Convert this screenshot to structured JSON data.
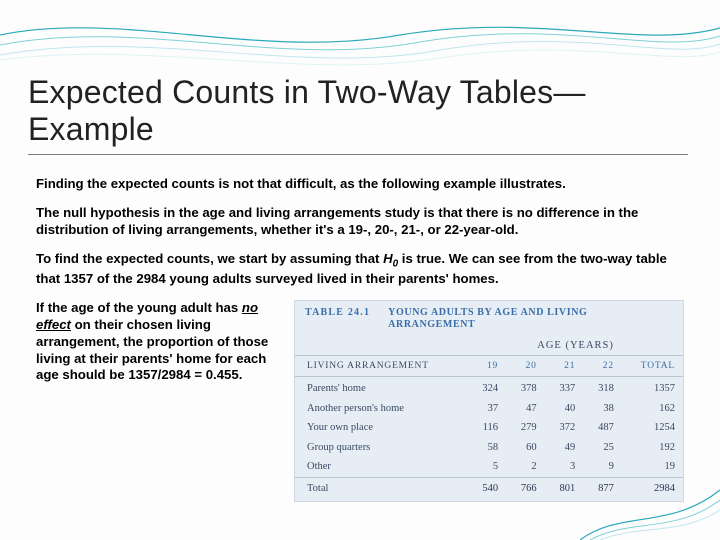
{
  "title": "Expected Counts in Two-Way Tables—Example",
  "para1": "Finding the expected counts is not that difficult, as the following example illustrates.",
  "para2": "The null hypothesis in the age and living arrangements study is that there is no difference in the distribution of living arrangements, whether it's a 19-, 20-, 21-, or 22-year-old.",
  "para3_a": "To find the expected counts, we start by assuming that ",
  "para3_hvar": "H",
  "para3_hsub": "0",
  "para3_b": " is true. We can see from the two-way table that 1357 of the 2984 young adults surveyed lived in their parents' homes.",
  "lower_a": "If the age of the young adult has ",
  "lower_noeffect": "no effect",
  "lower_b": " on their chosen living arrangement, the proportion of those living at their parents' home for each age should be 1357/2984 = 0.455.",
  "table": {
    "label": "TABLE 24.1",
    "title": "YOUNG ADULTS BY AGE AND LIVING ARRANGEMENT",
    "age_header": "AGE (YEARS)",
    "col_rowhdr": "LIVING ARRANGEMENT",
    "cols": [
      "19",
      "20",
      "21",
      "22",
      "TOTAL"
    ],
    "rows": [
      {
        "name": "Parents' home",
        "v": [
          "324",
          "378",
          "337",
          "318",
          "1357"
        ]
      },
      {
        "name": "Another person's home",
        "v": [
          "37",
          "47",
          "40",
          "38",
          "162"
        ]
      },
      {
        "name": "Your own place",
        "v": [
          "116",
          "279",
          "372",
          "487",
          "1254"
        ]
      },
      {
        "name": "Group quarters",
        "v": [
          "58",
          "60",
          "49",
          "25",
          "192"
        ]
      },
      {
        "name": "Other",
        "v": [
          "5",
          "2",
          "3",
          "9",
          "19"
        ]
      }
    ],
    "total": {
      "name": "Total",
      "v": [
        "540",
        "766",
        "801",
        "877",
        "2984"
      ]
    }
  },
  "chart_data": {
    "type": "table",
    "title": "Young adults by age and living arrangement",
    "columns": [
      "Living arrangement",
      "19",
      "20",
      "21",
      "22",
      "Total"
    ],
    "rows": [
      [
        "Parents' home",
        324,
        378,
        337,
        318,
        1357
      ],
      [
        "Another person's home",
        37,
        47,
        40,
        38,
        162
      ],
      [
        "Your own place",
        116,
        279,
        372,
        487,
        1254
      ],
      [
        "Group quarters",
        58,
        60,
        49,
        25,
        192
      ],
      [
        "Other",
        5,
        2,
        3,
        9,
        19
      ],
      [
        "Total",
        540,
        766,
        801,
        877,
        2984
      ]
    ]
  }
}
